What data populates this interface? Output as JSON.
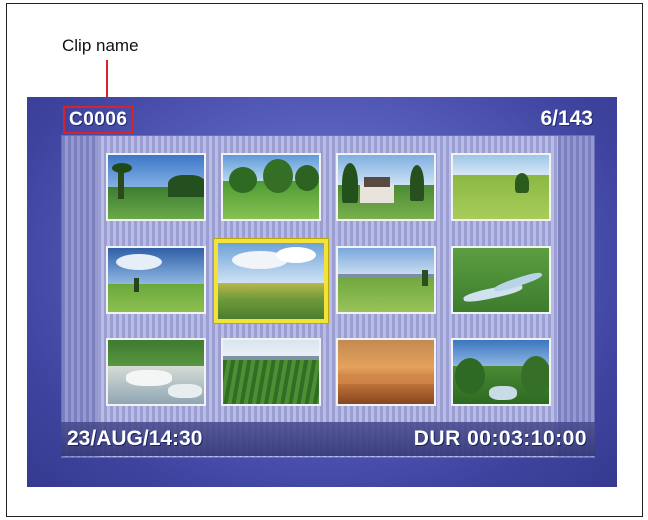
{
  "callout": {
    "label": "Clip name"
  },
  "screen": {
    "clip_name": "C0006",
    "clip_counter": "6/143",
    "date_time": "23/AUG/14:30",
    "duration": "DUR 00:03:10:00"
  },
  "thumbnails": [
    {
      "scene": "palm-trees-golf-course",
      "selected": false
    },
    {
      "scene": "trees-on-lawn",
      "selected": false
    },
    {
      "scene": "house-among-trees",
      "selected": false
    },
    {
      "scene": "lone-tree-field",
      "selected": false
    },
    {
      "scene": "cloudy-sky-field",
      "selected": false
    },
    {
      "scene": "rolling-farmland",
      "selected": true
    },
    {
      "scene": "meadow-with-mountains",
      "selected": false
    },
    {
      "scene": "forest-stream",
      "selected": false
    },
    {
      "scene": "waterfall-rocks",
      "selected": false
    },
    {
      "scene": "crop-rows-field",
      "selected": false
    },
    {
      "scene": "sunset-hills",
      "selected": false
    },
    {
      "scene": "river-through-forest",
      "selected": false
    }
  ],
  "colors": {
    "highlight": "#d8232a",
    "selection": "#f3e23a",
    "background": "#5a61bd"
  }
}
